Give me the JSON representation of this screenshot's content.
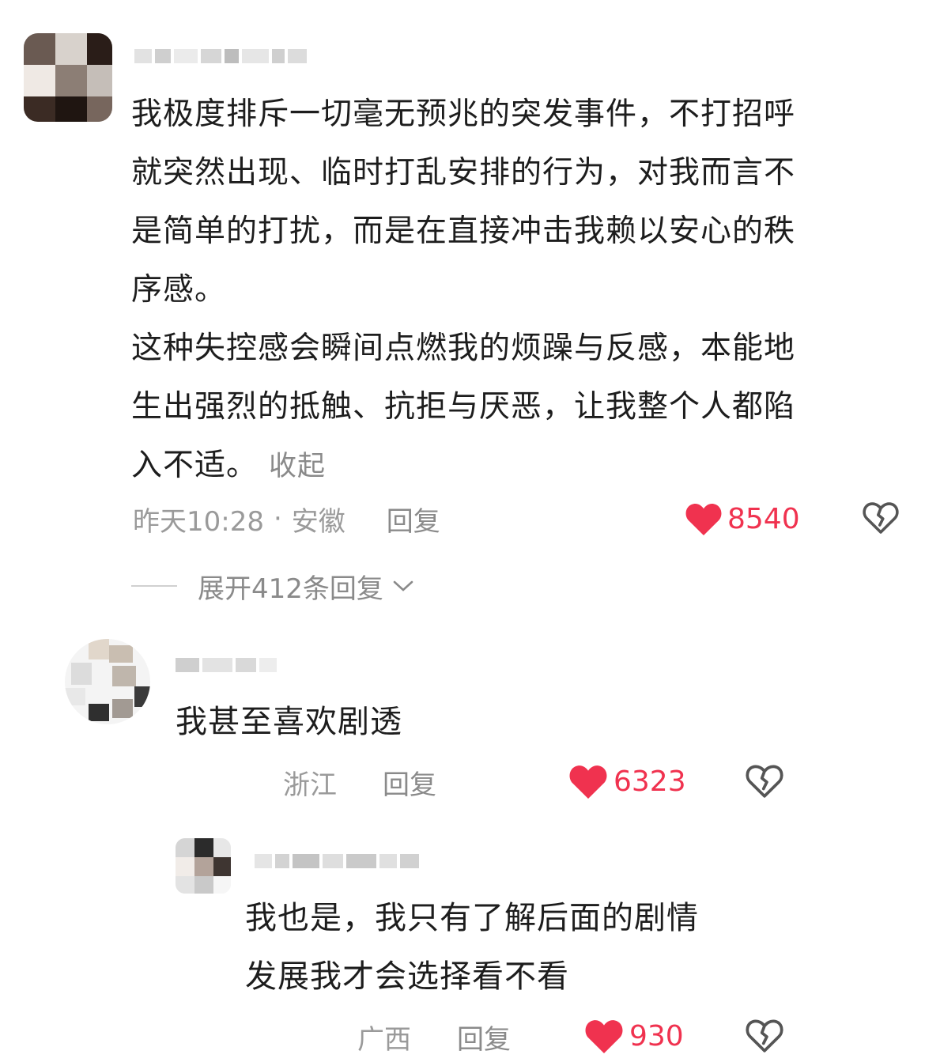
{
  "comment1": {
    "paragraphs": [
      "我极度排斥一切毫无预兆的突发事件，不打招呼就突然出现、临时打乱安排的行为，对我而言不是简单的打扰，而是在直接冲击我赖以安心的秩序感。",
      "这种失控感会瞬间点燃我的烦躁与反感，本能地生出强烈的抵触、抗拒与厌恶，让我整个人都陷入不适。"
    ],
    "lines": [
      "我极度排斥一切毫无预兆的突发事件，不打招呼",
      "就突然出现、临时打乱安排的行为，对我而言不",
      "是简单的打扰，而是在直接冲击我赖以安心的秩",
      "序感。",
      "这种失控感会瞬间点燃我的烦躁与反感，本能地",
      "生出强烈的抵触、抗拒与厌恶，让我整个人都陷",
      "入不适。"
    ],
    "collapse_label": "收起",
    "time": "昨天10:28",
    "separator": "·",
    "location": "安徽",
    "reply_label": "回复",
    "likes": "8540",
    "expand_label": "展开412条回复",
    "expand_icon": "chevron-down-icon"
  },
  "comment2": {
    "text": "我甚至喜欢剧透",
    "location": "浙江",
    "reply_label": "回复",
    "likes": "6323"
  },
  "comment3": {
    "lines": [
      "我也是，我只有了解后面的剧情",
      "发展我才会选择看不看"
    ],
    "location": "广西",
    "reply_label": "回复",
    "likes": "930"
  },
  "icons": {
    "like": "heart-icon",
    "dislike": "broken-heart-icon"
  },
  "colors": {
    "like": "#f0324f",
    "meta": "#9a9a9a",
    "text": "#1d1d1d"
  }
}
